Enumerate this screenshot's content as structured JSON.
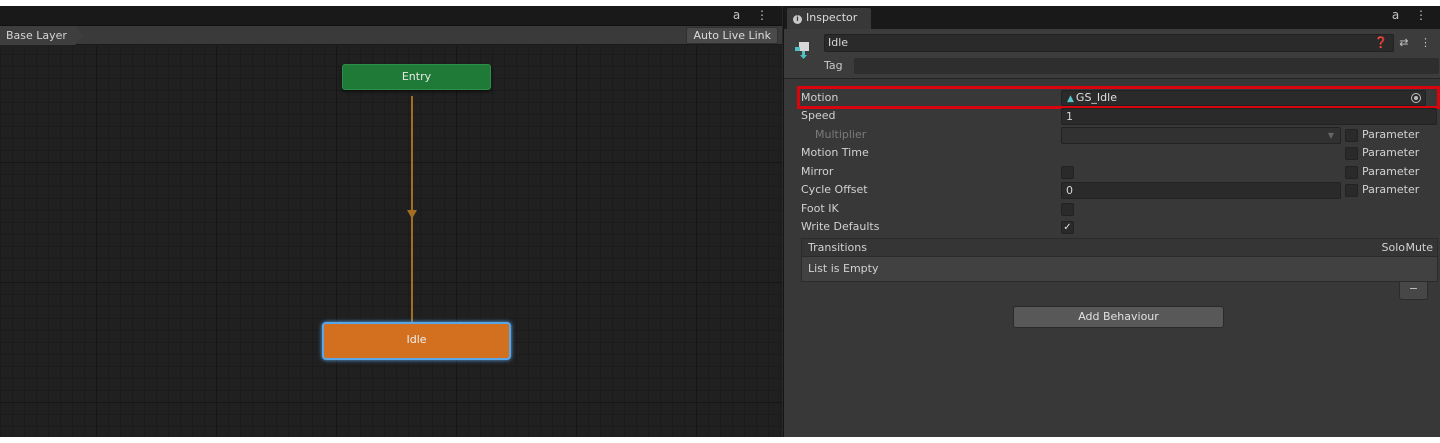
{
  "animator": {
    "breadcrumb": "Base Layer",
    "auto_live_link": "Auto Live Link",
    "tab_icons": "a ⋮",
    "nodes": {
      "entry": "Entry",
      "idle": "Idle"
    },
    "colors": {
      "entry": "#1f7a37",
      "idle": "#d3701f",
      "transition": "#a56d1f",
      "selection": "#59a6e8"
    }
  },
  "inspector": {
    "tab_label": "Inspector",
    "tab_icons": "a ⋮",
    "header_icons": "❓ ⇄ ⋮",
    "state": {
      "name": "Idle",
      "tag_label": "Tag",
      "tag_value": ""
    },
    "rows": {
      "motion": {
        "label": "Motion",
        "value": "GS_Idle"
      },
      "speed": {
        "label": "Speed",
        "value": "1"
      },
      "multiplier": {
        "label": "Multiplier",
        "value": "",
        "param_label": "Parameter"
      },
      "motion_time": {
        "label": "Motion Time",
        "param_label": "Parameter"
      },
      "mirror": {
        "label": "Mirror",
        "checked": false,
        "param_label": "Parameter"
      },
      "cycle_offset": {
        "label": "Cycle Offset",
        "value": "0",
        "param_label": "Parameter"
      },
      "foot_ik": {
        "label": "Foot IK",
        "checked": false
      },
      "write_defaults": {
        "label": "Write Defaults",
        "checked": true,
        "check_glyph": "✓"
      }
    },
    "transitions": {
      "label": "Transitions",
      "solo": "Solo",
      "mute": "Mute",
      "empty_text": "List is Empty",
      "remove_glyph": "−"
    },
    "add_behaviour": "Add Behaviour",
    "highlight_color": "#d8040e"
  }
}
